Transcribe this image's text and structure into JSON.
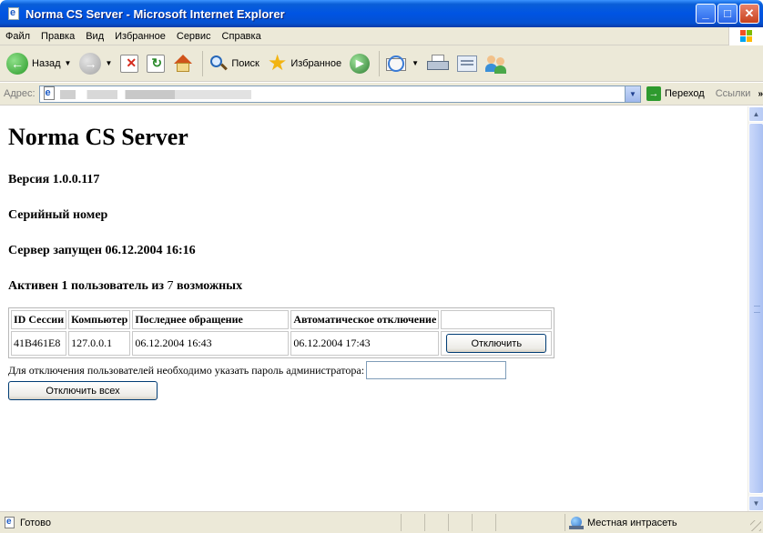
{
  "window": {
    "title": "Norma CS Server - Microsoft Internet Explorer"
  },
  "menu": {
    "items": [
      {
        "label": "Файл"
      },
      {
        "label": "Правка"
      },
      {
        "label": "Вид"
      },
      {
        "label": "Избранное"
      },
      {
        "label": "Сервис"
      },
      {
        "label": "Справка"
      }
    ]
  },
  "toolbar": {
    "back_label": "Назад",
    "search_label": "Поиск",
    "favorites_label": "Избранное"
  },
  "addressbar": {
    "label": "Адрес:",
    "go_label": "Переход",
    "links_label": "Ссылки",
    "links_chevron": "»"
  },
  "page": {
    "title": "Norma CS Server",
    "version": "Версия 1.0.0.117",
    "serial": "Серийный номер",
    "started": "Сервер запущен 06.12.2004 16:16",
    "active_prefix": "Активен 1 пользователь из ",
    "active_count": "7",
    "active_suffix": " возможных"
  },
  "sessions": {
    "headers": [
      "ID Сессии",
      "Компьютер",
      "Последнее обращение",
      "Автоматическое отключение"
    ],
    "rows": [
      {
        "id": "41B461E8",
        "computer": "127.0.0.1",
        "last_access": "06.12.2004 16:43",
        "auto_disconnect": "06.12.2004 17:43",
        "action": "Отключить"
      }
    ]
  },
  "admin": {
    "password_prompt": "Для отключения пользователей необходимо указать пароль администратора:",
    "password_value": "",
    "disconnect_all": "Отключить всех"
  },
  "statusbar": {
    "status": "Готово",
    "zone": "Местная интрасеть"
  }
}
